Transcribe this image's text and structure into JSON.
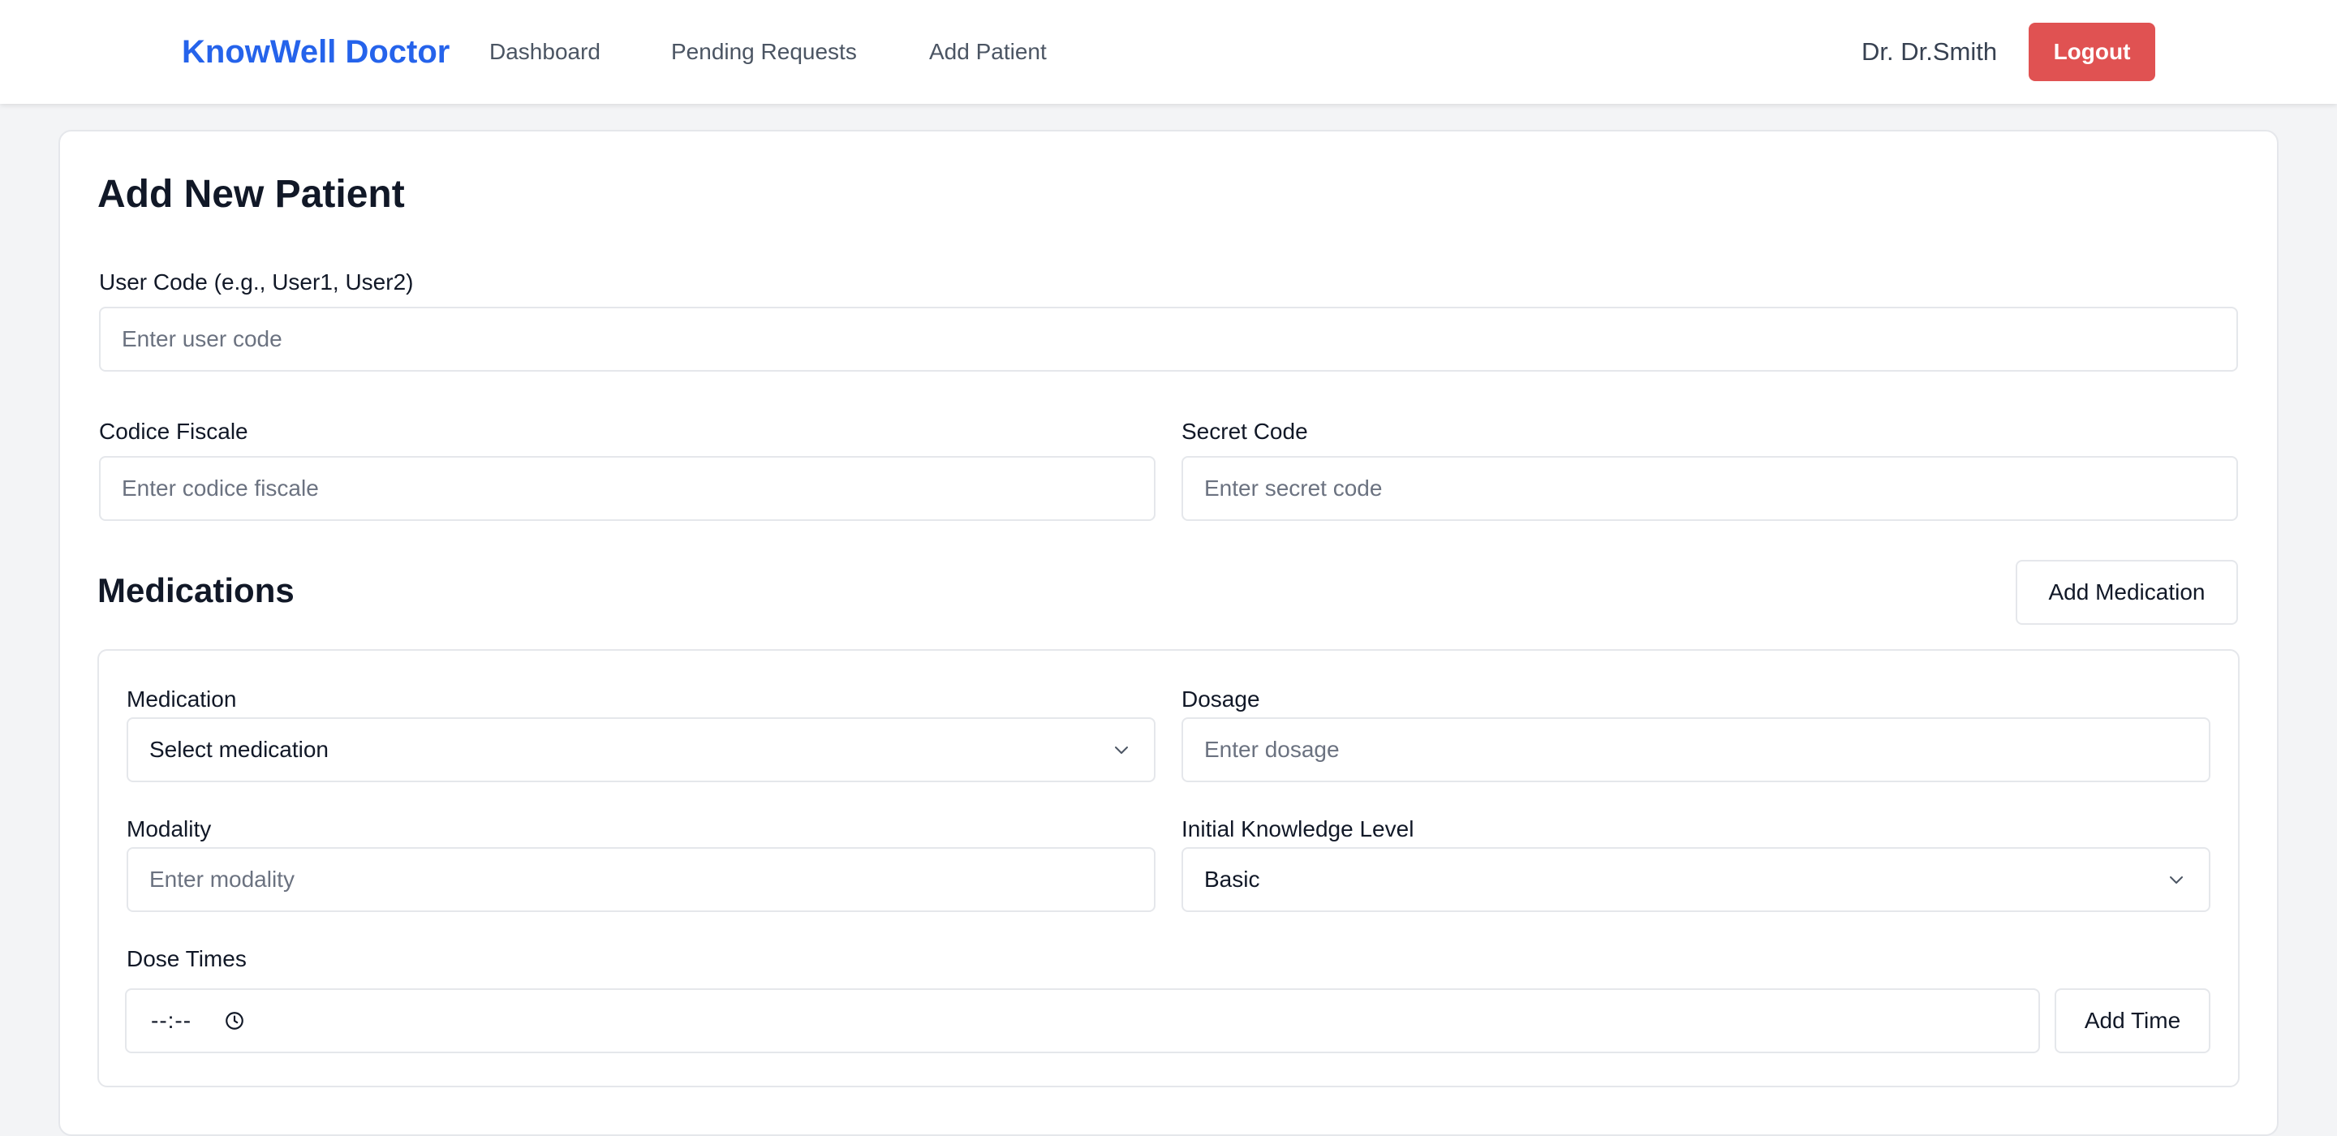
{
  "navbar": {
    "brand": "KnowWell Doctor",
    "links": [
      "Dashboard",
      "Pending Requests",
      "Add Patient"
    ],
    "user_name": "Dr. Dr.Smith",
    "logout_label": "Logout"
  },
  "form": {
    "title": "Add New Patient",
    "user_code": {
      "label": "User Code (e.g., User1, User2)",
      "placeholder": "Enter user code",
      "value": ""
    },
    "codice_fiscale": {
      "label": "Codice Fiscale",
      "placeholder": "Enter codice fiscale",
      "value": ""
    },
    "secret_code": {
      "label": "Secret Code",
      "placeholder": "Enter secret code",
      "value": ""
    }
  },
  "medications": {
    "title": "Medications",
    "add_label": "Add Medication",
    "items": [
      {
        "medication": {
          "label": "Medication",
          "selected": "Select medication"
        },
        "dosage": {
          "label": "Dosage",
          "placeholder": "Enter dosage",
          "value": ""
        },
        "modality": {
          "label": "Modality",
          "placeholder": "Enter modality",
          "value": ""
        },
        "knowledge_level": {
          "label": "Initial Knowledge Level",
          "selected": "Basic"
        },
        "dose_times": {
          "label": "Dose Times",
          "time_value": "--:--",
          "add_label": "Add Time"
        }
      }
    ]
  },
  "colors": {
    "brand": "#2563eb",
    "logout": "#e05252",
    "background": "#f3f4f6"
  }
}
